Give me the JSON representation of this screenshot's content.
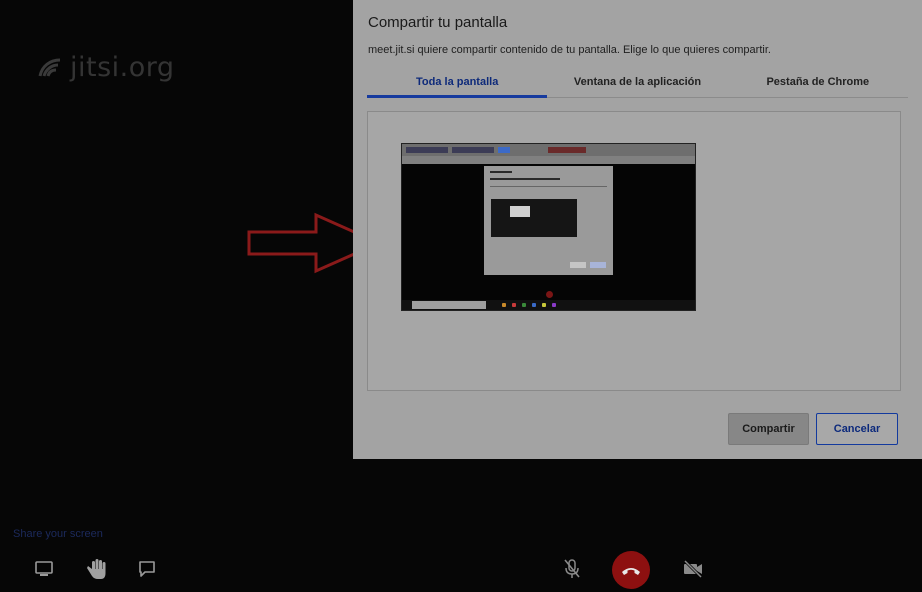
{
  "app": {
    "logo_text": "jitsi.org"
  },
  "dialog": {
    "title": "Compartir tu pantalla",
    "description": "meet.jit.si quiere compartir contenido de tu pantalla. Elige lo que quieres compartir.",
    "tabs": [
      {
        "label": "Toda la pantalla",
        "active": true
      },
      {
        "label": "Ventana de la aplicación",
        "active": false
      },
      {
        "label": "Pestaña de Chrome",
        "active": false
      }
    ],
    "share_label": "Compartir",
    "cancel_label": "Cancelar"
  },
  "toolbar": {
    "share_hint": "Share your screen",
    "icons": [
      "screen-share-icon",
      "raise-hand-icon",
      "chat-icon",
      "mic-muted-icon",
      "hangup-icon",
      "camera-off-icon"
    ]
  },
  "colors": {
    "accent": "#163a9e",
    "hangup": "#8d1010",
    "arrow": "#8a1a1a"
  }
}
